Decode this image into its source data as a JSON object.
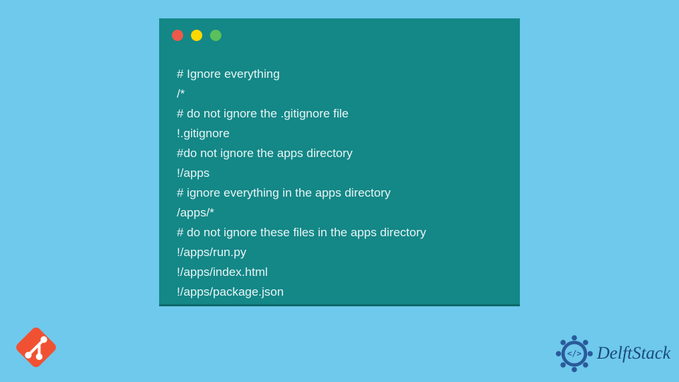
{
  "code": {
    "lines": [
      "# Ignore everything",
      "/*",
      "# do not ignore the .gitignore file",
      "!.gitignore",
      "#do not ignore the apps directory",
      "!/apps",
      "# ignore everything in the apps directory",
      "/apps/*",
      "# do not ignore these files in the apps directory",
      "!/apps/run.py",
      "!/apps/index.html",
      "!/apps/package.json"
    ]
  },
  "branding": {
    "site_name": "DelftStack"
  }
}
